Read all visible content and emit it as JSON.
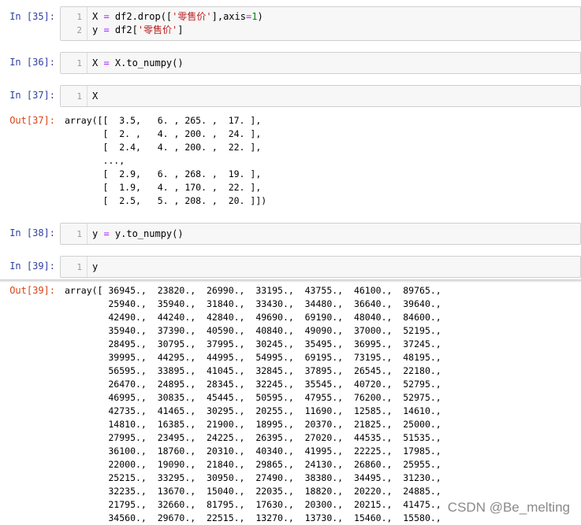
{
  "cells": [
    {
      "prompt": "In  [35]:",
      "lines": [
        "1",
        "2"
      ],
      "code": [
        "X = df2.drop(['零售价'],axis=1)",
        "y = df2['零售价']"
      ]
    },
    {
      "prompt": "In  [36]:",
      "lines": [
        "1"
      ],
      "code": [
        "X = X.to_numpy()"
      ]
    },
    {
      "prompt": "In  [37]:",
      "lines": [
        "1"
      ],
      "code": [
        "X"
      ]
    },
    {
      "prompt": "In  [38]:",
      "lines": [
        "1"
      ],
      "code": [
        "y = y.to_numpy()"
      ]
    },
    {
      "prompt": "In  [39]:",
      "lines": [
        "1"
      ],
      "code": [
        "y"
      ]
    }
  ],
  "outputs": [
    {
      "prompt": "Out[37]:",
      "text": "array([[  3.5,   6. , 265. ,  17. ],\n       [  2. ,   4. , 200. ,  24. ],\n       [  2.4,   4. , 200. ,  22. ],\n       ...,\n       [  2.9,   6. , 268. ,  19. ],\n       [  1.9,   4. , 170. ,  22. ],\n       [  2.5,   5. , 208. ,  20. ]])"
    },
    {
      "prompt": "Out[39]:",
      "text": "array([ 36945.,  23820.,  26990.,  33195.,  43755.,  46100.,  89765.,\n        25940.,  35940.,  31840.,  33430.,  34480.,  36640.,  39640.,\n        42490.,  44240.,  42840.,  49690.,  69190.,  48040.,  84600.,\n        35940.,  37390.,  40590.,  40840.,  49090.,  37000.,  52195.,\n        28495.,  30795.,  37995.,  30245.,  35495.,  36995.,  37245.,\n        39995.,  44295.,  44995.,  54995.,  69195.,  73195.,  48195.,\n        56595.,  33895.,  41045.,  32845.,  37895.,  26545.,  22180.,\n        26470.,  24895.,  28345.,  32245.,  35545.,  40720.,  52795.,\n        46995.,  30835.,  45445.,  50595.,  47955.,  76200.,  52975.,\n        42735.,  41465.,  30295.,  20255.,  11690.,  12585.,  14610.,\n        14810.,  16385.,  21900.,  18995.,  20370.,  21825.,  25000.,\n        27995.,  23495.,  24225.,  26395.,  27020.,  44535.,  51535.,\n        36100.,  18760.,  20310.,  40340.,  41995.,  22225.,  17985.,\n        22000.,  19090.,  21840.,  29865.,  24130.,  26860.,  25955.,\n        25215.,  33295.,  30950.,  27490.,  38380.,  34495.,  31230.,\n        32235.,  13670.,  15040.,  22035.,  18820.,  20220.,  24885.,\n        21795.,  32660.,  81795.,  17630.,  20300.,  20215.,  41475.,\n        34560.,  29670.,  22515.,  13270.,  13730.,  15460.,  15580.,"
    }
  ],
  "watermark": "CSDN @Be_melting"
}
